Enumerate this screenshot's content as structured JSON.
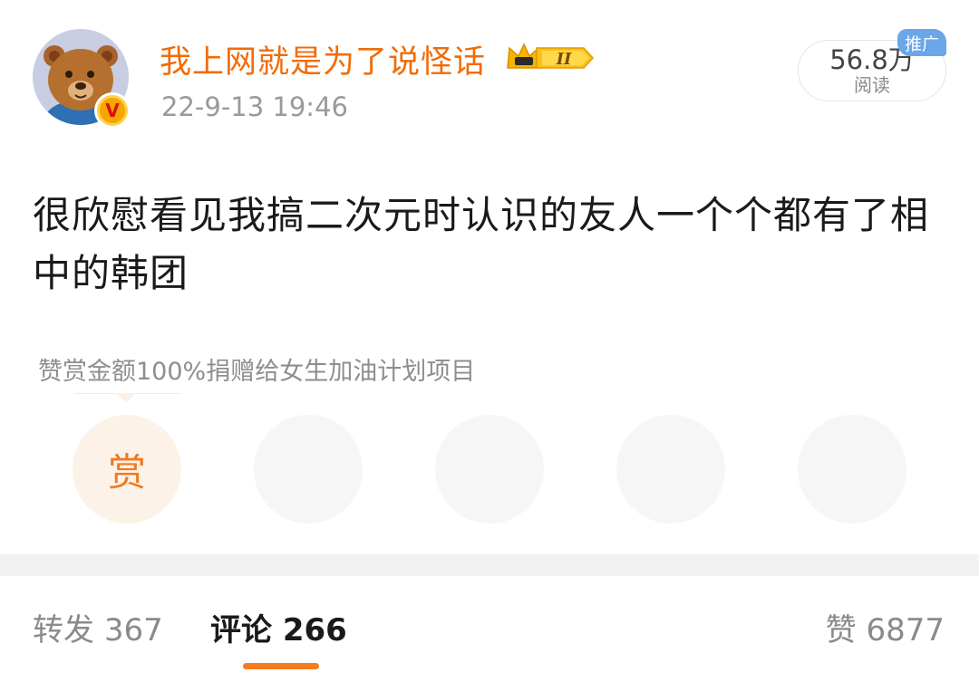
{
  "post": {
    "author": {
      "name": "我上网就是为了说怪话",
      "verified_badge": "V",
      "level_badge": "II"
    },
    "timestamp": "22-9-13 19:46",
    "reads": {
      "count": "56.8万",
      "label": "阅读"
    },
    "promo_tag": "推广",
    "text": "很欣慰看见我搞二次元时认识的友人一个个都有了相中的韩团",
    "reward_note": "赞赏金额100%捐赠给女生加油计划项目",
    "reward_button": "赏"
  },
  "stats": {
    "repost_label": "转发",
    "repost_count": "367",
    "comment_label": "评论",
    "comment_count": "266",
    "like_label": "赞",
    "like_count": "6877"
  },
  "colors": {
    "username": "#f26b07",
    "accent": "#f77b1e",
    "promo": "#6aa6e8"
  }
}
